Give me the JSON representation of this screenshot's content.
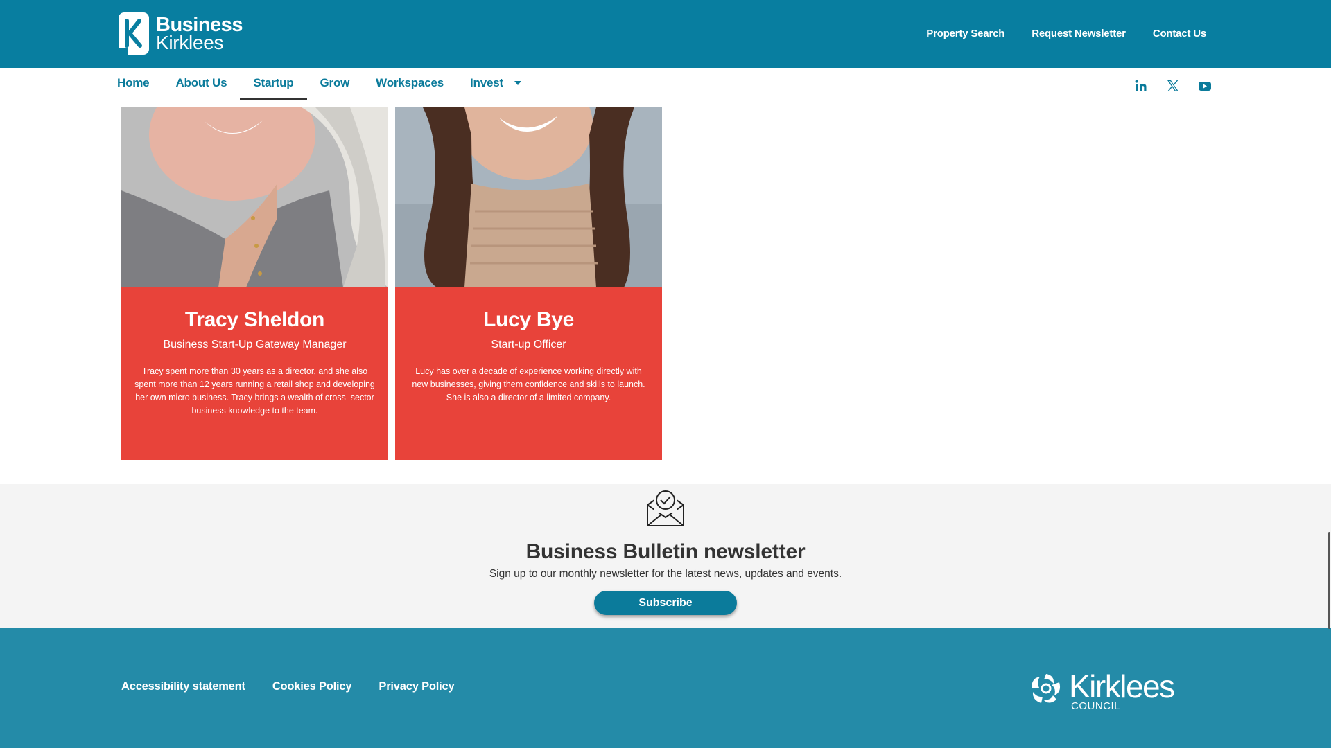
{
  "brand": {
    "logo_line1": "Business",
    "logo_line2": "Kirklees",
    "primary_color": "#087ea0",
    "card_color": "#e8433a"
  },
  "header": {
    "links": [
      "Property Search",
      "Request Newsletter",
      "Contact Us"
    ]
  },
  "nav": {
    "items": [
      {
        "label": "Home"
      },
      {
        "label": "About Us"
      },
      {
        "label": "Startup"
      },
      {
        "label": "Grow"
      },
      {
        "label": "Workspaces"
      },
      {
        "label": "Invest"
      }
    ],
    "active": "Startup",
    "social_icons": [
      "linkedin-icon",
      "x-twitter-icon",
      "youtube-icon"
    ]
  },
  "team": [
    {
      "name": "Tracy Sheldon",
      "role": "Business Start-Up Gateway Manager",
      "bio": "Tracy spent more than 30 years as a director, and she also spent more than 12 years running a retail shop and developing her own micro business.  Tracy brings a wealth of cross–sector business knowledge to the team."
    },
    {
      "name": "Lucy Bye",
      "role": "Start-up Officer",
      "bio": "Lucy has over a decade of experience working directly with new businesses, giving them confidence and skills to launch. She is also a director of a limited company."
    }
  ],
  "newsletter": {
    "icon": "envelope-check-icon",
    "title": "Business Bulletin newsletter",
    "subtitle": "Sign up to our monthly newsletter for the latest news, updates and events.",
    "button": "Subscribe"
  },
  "footer": {
    "links": [
      "Accessibility statement",
      "Cookies Policy",
      "Privacy Policy"
    ],
    "council_name": "Kirklees",
    "council_sub": "COUNCIL"
  }
}
